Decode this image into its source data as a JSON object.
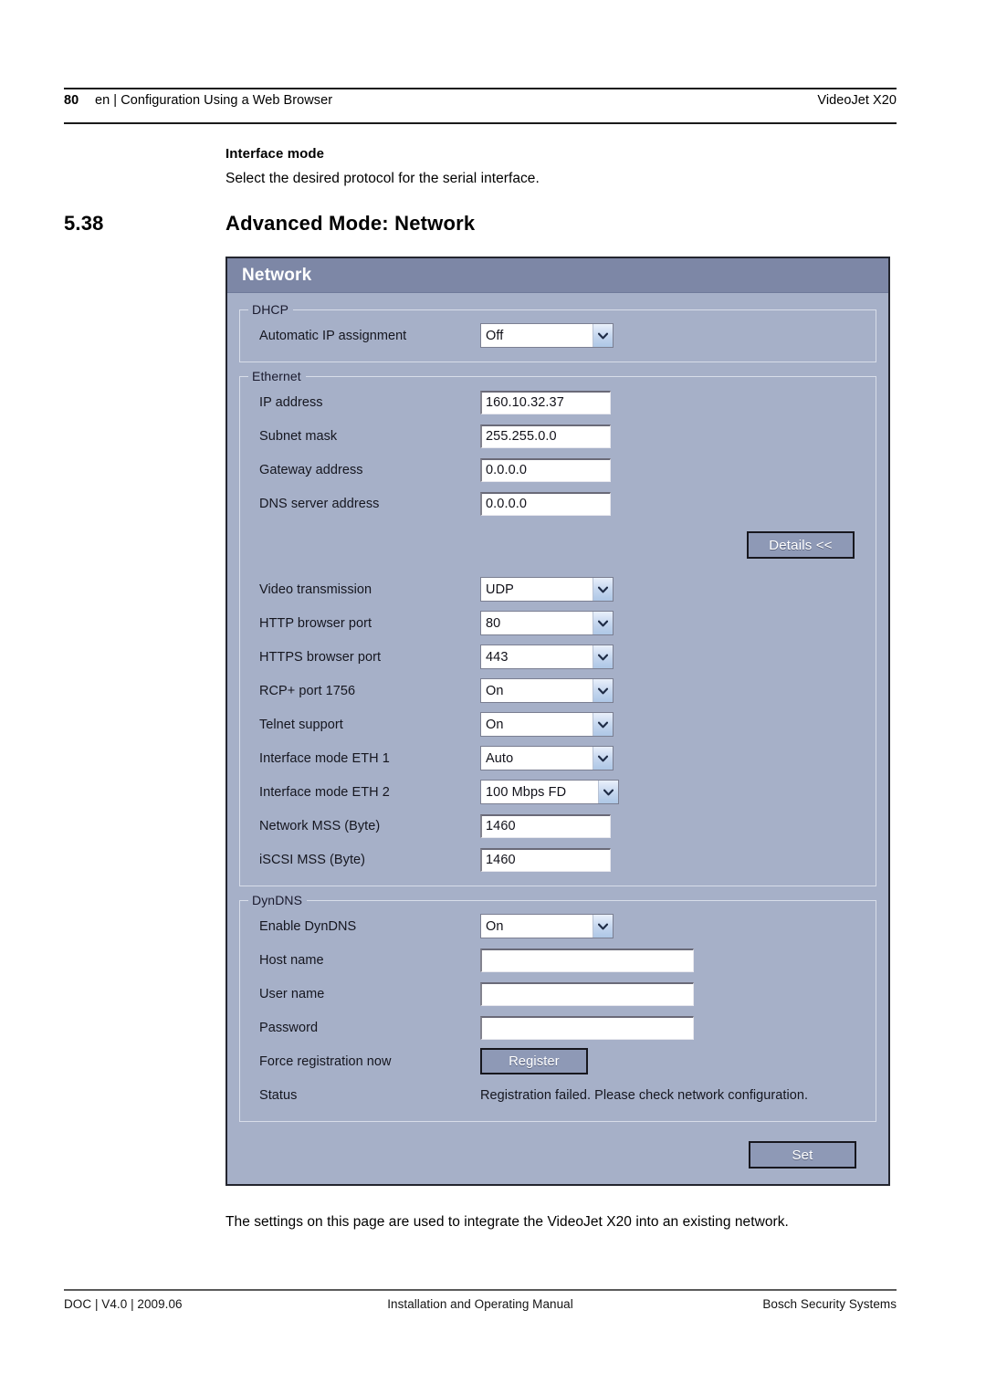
{
  "page_header": {
    "page_number": "80",
    "breadcrumb": "en | Configuration Using a Web Browser",
    "product": "VideoJet X20"
  },
  "intro": {
    "title": "Interface mode",
    "text": "Select the desired protocol for the serial interface."
  },
  "section": {
    "number": "5.38",
    "title": "Advanced Mode: Network"
  },
  "panel": {
    "title": "Network",
    "groups": {
      "dhcp": {
        "legend": "DHCP",
        "rows": [
          {
            "label": "Automatic IP assignment",
            "value": "Off",
            "control": "select"
          }
        ]
      },
      "ethernet": {
        "legend": "Ethernet",
        "rows": [
          {
            "label": "IP address",
            "value": "160.10.32.37",
            "control": "text"
          },
          {
            "label": "Subnet mask",
            "value": "255.255.0.0",
            "control": "text"
          },
          {
            "label": "Gateway address",
            "value": "0.0.0.0",
            "control": "text"
          },
          {
            "label": "DNS server address",
            "value": "0.0.0.0",
            "control": "text"
          }
        ],
        "details_button": "Details <<",
        "rows2": [
          {
            "label": "Video transmission",
            "value": "UDP",
            "control": "select"
          },
          {
            "label": "HTTP browser port",
            "value": "80",
            "control": "select"
          },
          {
            "label": "HTTPS browser port",
            "value": "443",
            "control": "select"
          },
          {
            "label": "RCP+ port 1756",
            "value": "On",
            "control": "select"
          },
          {
            "label": "Telnet support",
            "value": "On",
            "control": "select"
          },
          {
            "label": "Interface mode ETH 1",
            "value": "Auto",
            "control": "select"
          },
          {
            "label": "Interface mode ETH 2",
            "value": "100 Mbps FD",
            "control": "select-wide"
          },
          {
            "label": "Network MSS (Byte)",
            "value": "1460",
            "control": "text"
          },
          {
            "label": "iSCSI MSS (Byte)",
            "value": "1460",
            "control": "text"
          }
        ]
      },
      "dyndns": {
        "legend": "DynDNS",
        "rows": [
          {
            "label": "Enable DynDNS",
            "value": "On",
            "control": "select"
          },
          {
            "label": "Host name",
            "value": "",
            "control": "text-wide"
          },
          {
            "label": "User name",
            "value": "",
            "control": "text-wide"
          },
          {
            "label": "Password",
            "value": "",
            "control": "text-wide"
          }
        ],
        "force_registration_label": "Force registration now",
        "register_button": "Register",
        "status_label": "Status",
        "status_value": "Registration failed. Please check network configuration."
      }
    },
    "set_button": "Set"
  },
  "caption": "The settings on this page are used to integrate the VideoJet X20 into an existing network.",
  "page_footer": {
    "left": "DOC | V4.0 | 2009.06",
    "center": "Installation and Operating Manual",
    "right": "Bosch Security Systems"
  },
  "colors": {
    "panel_titlebar": "#7d87a6",
    "panel_body": "#a6b0c8",
    "button_face": "#8e99b6",
    "panel_border": "#23252e"
  }
}
